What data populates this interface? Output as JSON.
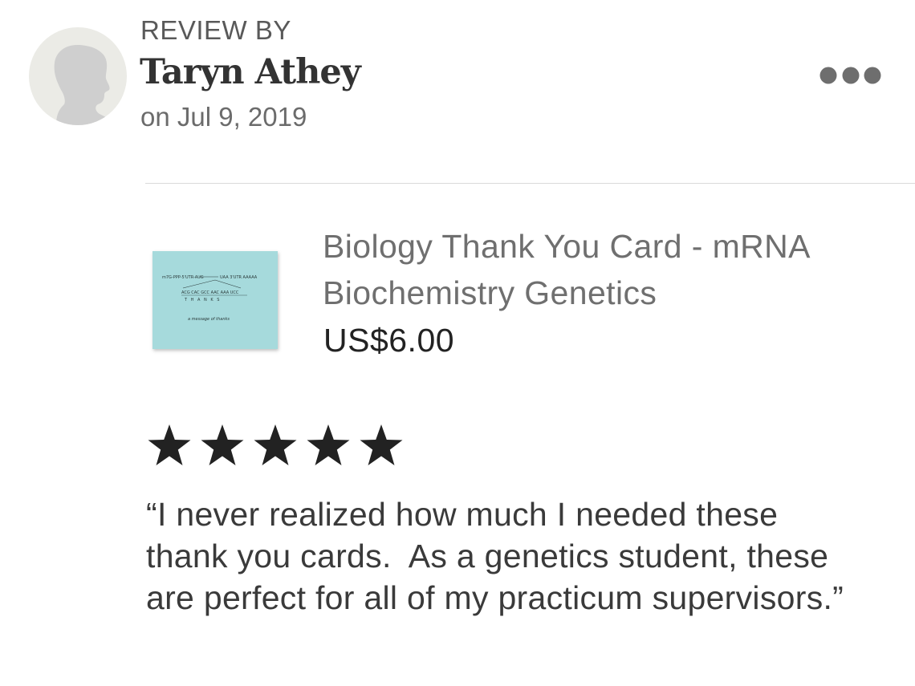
{
  "review": {
    "label": "REVIEW BY",
    "reviewer_name": "Taryn Athey",
    "date": "on Jul 9, 2019",
    "avatar_icon": "default-avatar-silhouette",
    "more_icon": "more-dots-icon"
  },
  "product": {
    "title": "Biology Thank You Card - mRNA Biochemistry Genetics",
    "price": "US$6.00",
    "thumbnail_color": "#a6dadc",
    "thumbnail_text": {
      "line1": "m7G-PPP-5'UTR-AUG",
      "line1b": "UAA 3'UTR AAAAA",
      "line2": "ACG CAC GCC AAC AAA UCC",
      "line3": "T H A N K S",
      "line4": "a message of thanks"
    }
  },
  "rating": {
    "stars": 5,
    "max_stars": 5,
    "star_color": "#222222"
  },
  "review_text": "“I never realized how much I needed these thank you cards.  As a genetics student, these are perfect for all of my practicum supervisors.”",
  "colors": {
    "divider": "#dadada",
    "avatar_bg": "#ebebe6",
    "avatar_silhouette": "#cfcfcf"
  }
}
